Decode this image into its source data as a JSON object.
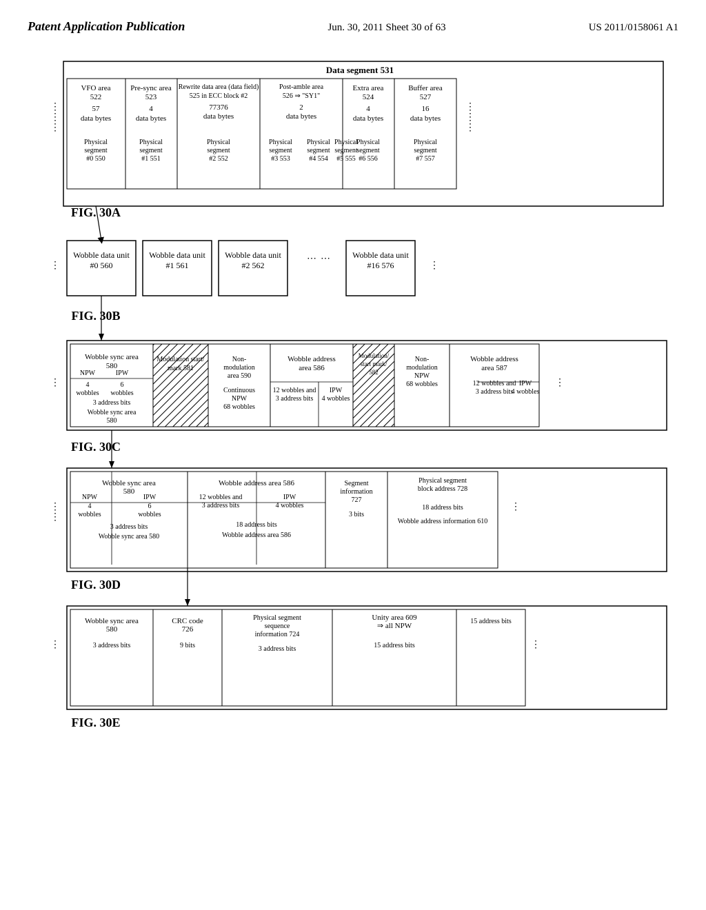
{
  "header": {
    "left": "Patent Application Publication",
    "center": "Jun. 30, 2011   Sheet 30 of 63",
    "right": "US 2011/0158061 A1"
  },
  "figures": {
    "30A": "FIG. 30A",
    "30B": "FIG. 30B",
    "30C": "FIG. 30C",
    "30D": "FIG. 30D",
    "30E": "FIG. 30E"
  }
}
